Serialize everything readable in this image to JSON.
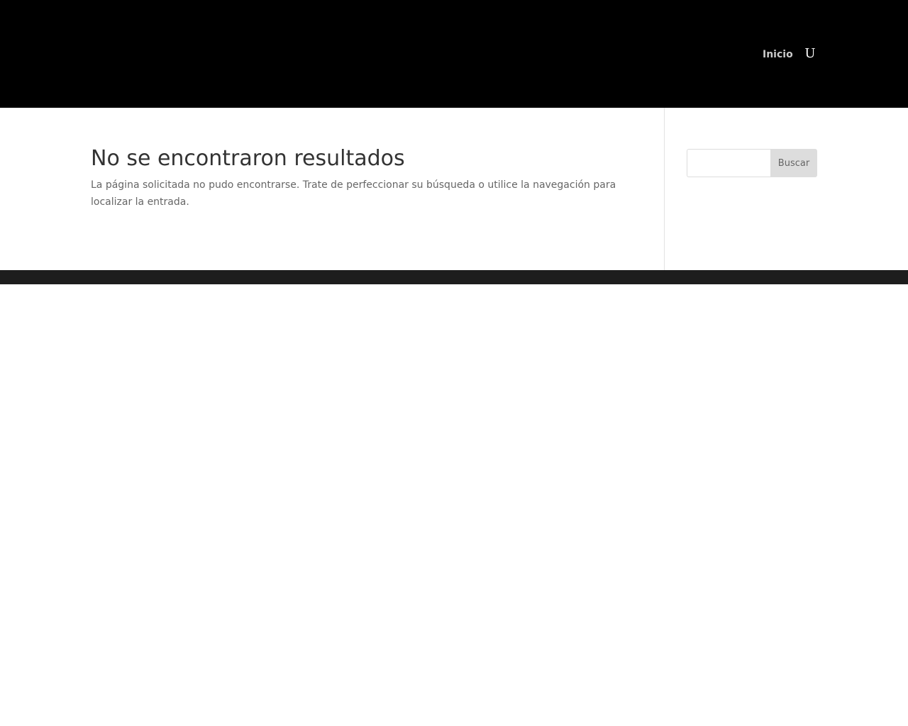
{
  "header": {
    "nav_items": [
      {
        "label": "Inicio"
      }
    ],
    "search_toggle_glyph": "U",
    "background": "#000000"
  },
  "main": {
    "title": "No se encontraron resultados",
    "message": "La página solicitada no pudo encontrarse. Trate de perfeccionar su búsqueda o utilice la navegación para localizar la entrada."
  },
  "sidebar": {
    "search": {
      "value": "",
      "placeholder": "",
      "button_label": "Buscar"
    }
  },
  "colors": {
    "nav_text": "#c9c9c9",
    "title_text": "#333333",
    "body_text": "#666666",
    "button_bg": "#dddddd",
    "footer_bar": "#1d1d1d"
  }
}
